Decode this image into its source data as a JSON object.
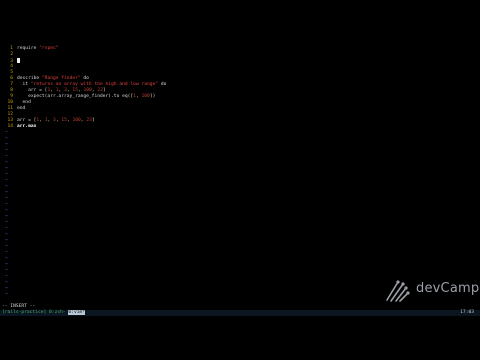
{
  "code_lines": [
    {
      "num": "1",
      "parts": [
        {
          "t": "require ",
          "c": "kw"
        },
        {
          "t": "\"rspec\"",
          "c": "str"
        }
      ]
    },
    {
      "num": "2",
      "parts": []
    },
    {
      "num": "3",
      "parts": [],
      "cursor": true
    },
    {
      "num": "4",
      "parts": []
    },
    {
      "num": "5",
      "parts": []
    },
    {
      "num": "6",
      "parts": [
        {
          "t": "describe ",
          "c": "kw"
        },
        {
          "t": "\"Range finder\"",
          "c": "str"
        },
        {
          "t": " do",
          "c": "kw"
        }
      ]
    },
    {
      "num": "7",
      "parts": [
        {
          "t": "  it ",
          "c": "kw"
        },
        {
          "t": "\"returns an array with the high and low range\"",
          "c": "str"
        },
        {
          "t": " do",
          "c": "kw"
        }
      ]
    },
    {
      "num": "8",
      "parts": [
        {
          "t": "    arr = [",
          "c": "id"
        },
        {
          "t": "1",
          "c": "num"
        },
        {
          "t": ", ",
          "c": "id"
        },
        {
          "t": "1",
          "c": "num"
        },
        {
          "t": ", ",
          "c": "id"
        },
        {
          "t": "3",
          "c": "num"
        },
        {
          "t": ", ",
          "c": "id"
        },
        {
          "t": "15",
          "c": "num"
        },
        {
          "t": ", ",
          "c": "id"
        },
        {
          "t": "100",
          "c": "num"
        },
        {
          "t": ", ",
          "c": "id"
        },
        {
          "t": "23",
          "c": "num"
        },
        {
          "t": "]",
          "c": "id"
        }
      ]
    },
    {
      "num": "9",
      "parts": [
        {
          "t": "    expect(arr.array_range_finder).to eq([",
          "c": "id"
        },
        {
          "t": "1",
          "c": "num"
        },
        {
          "t": ", ",
          "c": "id"
        },
        {
          "t": "100",
          "c": "num"
        },
        {
          "t": "])",
          "c": "id"
        }
      ]
    },
    {
      "num": "10",
      "parts": [
        {
          "t": "  end",
          "c": "kw"
        }
      ]
    },
    {
      "num": "11",
      "parts": [
        {
          "t": "end",
          "c": "kw"
        }
      ]
    },
    {
      "num": "12",
      "parts": []
    },
    {
      "num": "13",
      "parts": [
        {
          "t": "arr = [",
          "c": "id"
        },
        {
          "t": "1",
          "c": "num"
        },
        {
          "t": ", ",
          "c": "id"
        },
        {
          "t": "1",
          "c": "num"
        },
        {
          "t": ", ",
          "c": "id"
        },
        {
          "t": "3",
          "c": "num"
        },
        {
          "t": ", ",
          "c": "id"
        },
        {
          "t": "15",
          "c": "num"
        },
        {
          "t": ", ",
          "c": "id"
        },
        {
          "t": "100",
          "c": "num"
        },
        {
          "t": ", ",
          "c": "id"
        },
        {
          "t": "23",
          "c": "num"
        },
        {
          "t": "]",
          "c": "id"
        }
      ]
    },
    {
      "num": "14",
      "parts": [
        {
          "t": "arr.max",
          "c": "bright"
        }
      ]
    }
  ],
  "tilde_char": "~",
  "tilde_count": 28,
  "mode_indicator": "-- INSERT --",
  "statusbar": {
    "left": "[rails-practice] ",
    "highlighted": "0:vim*",
    "highlight_prefix": "0:zsh- ",
    "right": "17:03"
  },
  "logo": {
    "text": "devCamp",
    "icon": "devcamp-crane-icon"
  },
  "colors": {
    "line_number": "#c6a400",
    "tilde": "#3f61d6",
    "string": "#e24040",
    "number": "#c0402a",
    "status_green": "#3fae6a"
  }
}
